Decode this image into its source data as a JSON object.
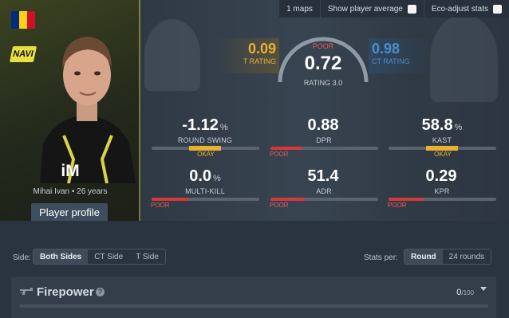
{
  "toolbar": {
    "maps": "1 maps",
    "show_avg": "Show player average",
    "eco": "Eco-adjust stats"
  },
  "player": {
    "nickname": "iM",
    "sub": "Mihai Ivan • 26 years",
    "profile_button": "Player profile",
    "flag_colors": [
      "#002b7f",
      "#fcd116",
      "#ce1126"
    ],
    "team_logo_text": "NAVI"
  },
  "rating": {
    "t_value": "0.09",
    "t_label": "T RATING",
    "overall_quality": "POOR",
    "overall_value": "0.72",
    "overall_label": "RATING 3.0",
    "ct_value": "0.98",
    "ct_label": "CT RATING"
  },
  "stats": [
    {
      "value": "-1.12",
      "unit": "%",
      "label": "ROUND SWING",
      "quality": "OKAY",
      "fill": 0.5
    },
    {
      "value": "0.88",
      "unit": "",
      "label": "DPR",
      "quality": "POOR",
      "fill": 0.3
    },
    {
      "value": "58.8",
      "unit": "%",
      "label": "KAST",
      "quality": "OKAY",
      "fill": 0.5
    },
    {
      "value": "0.0",
      "unit": "%",
      "label": "MULTI-KILL",
      "quality": "POOR",
      "fill": 0.35
    },
    {
      "value": "51.4",
      "unit": "",
      "label": "ADR",
      "quality": "POOR",
      "fill": 0.32
    },
    {
      "value": "0.29",
      "unit": "",
      "label": "KPR",
      "quality": "POOR",
      "fill": 0.33
    }
  ],
  "filters": {
    "side_label": "Side:",
    "side_options": [
      "Both Sides",
      "CT Side",
      "T Side"
    ],
    "stats_per_label": "Stats per:",
    "per_options": [
      "Round",
      "24 rounds"
    ]
  },
  "firepower": {
    "title": "Firepower",
    "help": "?",
    "score": "0",
    "score_max": "/100"
  }
}
